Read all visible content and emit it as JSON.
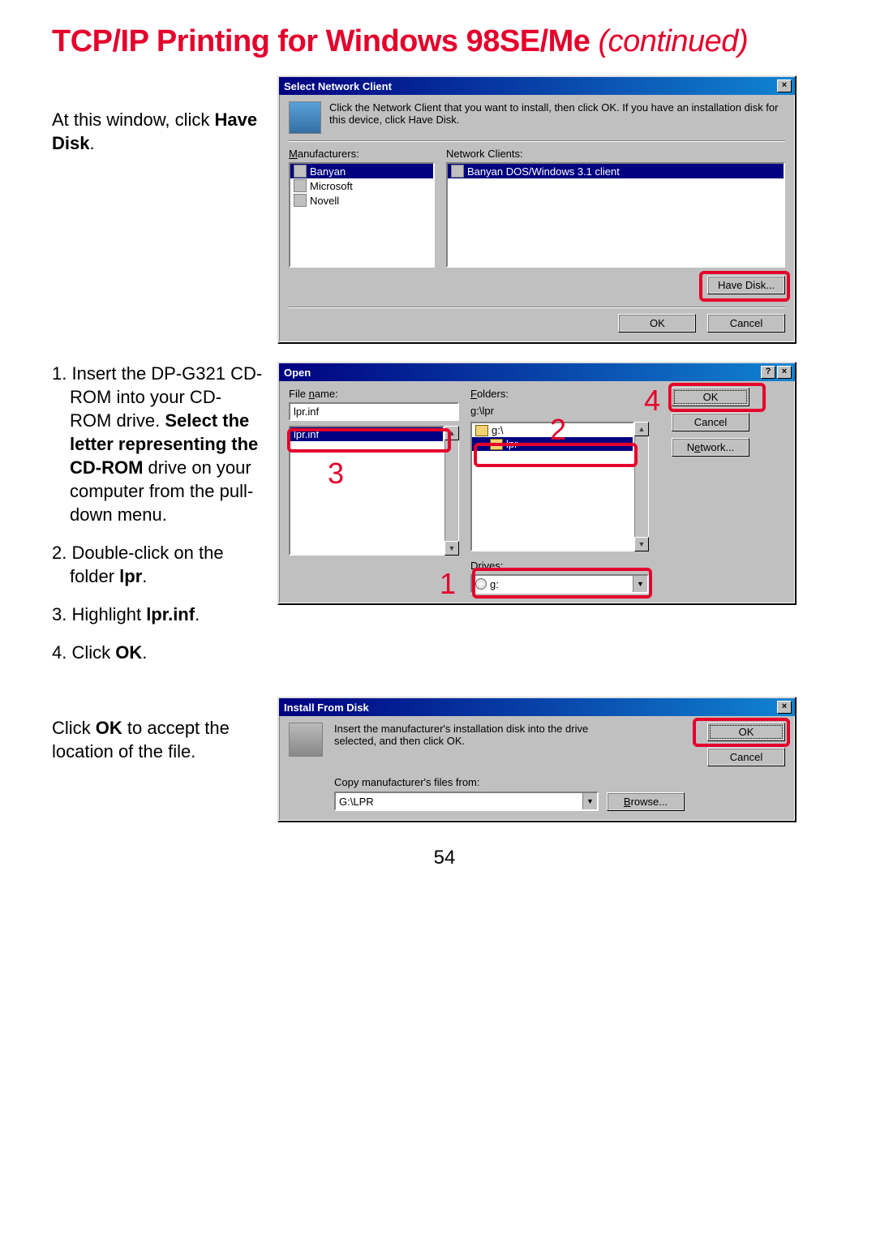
{
  "doc": {
    "heading_main": "TCP/IP Printing for Windows 98SE/Me ",
    "heading_sub": "(continued)",
    "page_number": "54"
  },
  "block1": {
    "instr_pre": "At this window, click ",
    "instr_bold": "Have Disk",
    "instr_post": "."
  },
  "dlg1": {
    "title": "Select Network Client",
    "desc": "Click the Network Client that you want to install, then click OK. If you have an installation disk for this device, click Have Disk.",
    "manuf_label": "Manufacturers:",
    "clients_label": "Network Clients:",
    "manuf_items": [
      "Banyan",
      "Microsoft",
      "Novell"
    ],
    "client_item": "Banyan DOS/Windows 3.1 client",
    "have_disk": "Have Disk...",
    "ok": "OK",
    "cancel": "Cancel"
  },
  "block2": {
    "s1a": "Insert the DP-G321 CD-ROM into your CD-ROM drive. ",
    "s1b": "Select the letter representing the CD-ROM",
    "s1c": " drive on your computer from the pull-down menu.",
    "s2a": "Double-click on the folder ",
    "s2b": "lpr",
    "s2c": ".",
    "s3a": "Highlight ",
    "s3b": "lpr.inf",
    "s3c": ".",
    "s4a": "Click ",
    "s4b": "OK",
    "s4c": "."
  },
  "dlg2": {
    "title": "Open",
    "filename_label": "File name:",
    "filename_value": "lpr.inf",
    "file_item": "lpr.inf",
    "folders_label": "Folders:",
    "folders_path": "g:\\lpr",
    "folder_root": "g:\\",
    "folder_sub": "lpr",
    "drives_label": "Drives:",
    "drive_value": "g:",
    "ok": "OK",
    "cancel": "Cancel",
    "network": "Network...",
    "call1": "1",
    "call2": "2",
    "call3": "3",
    "call4": "4"
  },
  "block3": {
    "pre": "Click ",
    "bold": "OK",
    "post": " to accept the location of the file."
  },
  "dlg3": {
    "title": "Install From Disk",
    "desc": "Insert the manufacturer's installation disk into the drive selected, and then click OK.",
    "copy_label": "Copy manufacturer's files from:",
    "path_value": "G:\\LPR",
    "ok": "OK",
    "cancel": "Cancel",
    "browse": "Browse..."
  }
}
